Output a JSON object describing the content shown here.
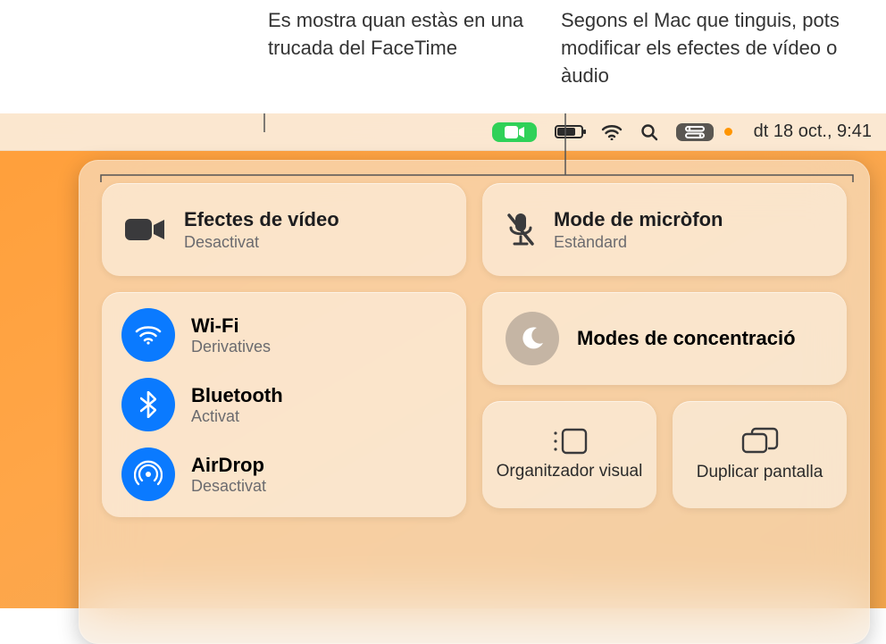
{
  "callouts": {
    "left": "Es mostra quan estàs en una trucada del FaceTime",
    "right": "Segons el Mac que tinguis, pots modificar els efectes de vídeo o àudio"
  },
  "menubar": {
    "clock": "dt 18 oct., 9:41"
  },
  "cc": {
    "video_effects": {
      "title": "Efectes de vídeo",
      "status": "Desactivat"
    },
    "mic_mode": {
      "title": "Mode de micròfon",
      "status": "Estàndard"
    },
    "wifi": {
      "title": "Wi-Fi",
      "status": "Derivatives"
    },
    "bluetooth": {
      "title": "Bluetooth",
      "status": "Activat"
    },
    "airdrop": {
      "title": "AirDrop",
      "status": "Desactivat"
    },
    "focus": {
      "title": "Modes de concentració"
    },
    "stage_manager": {
      "label": "Organitzador visual"
    },
    "mirror": {
      "label": "Duplicar pantalla"
    }
  }
}
